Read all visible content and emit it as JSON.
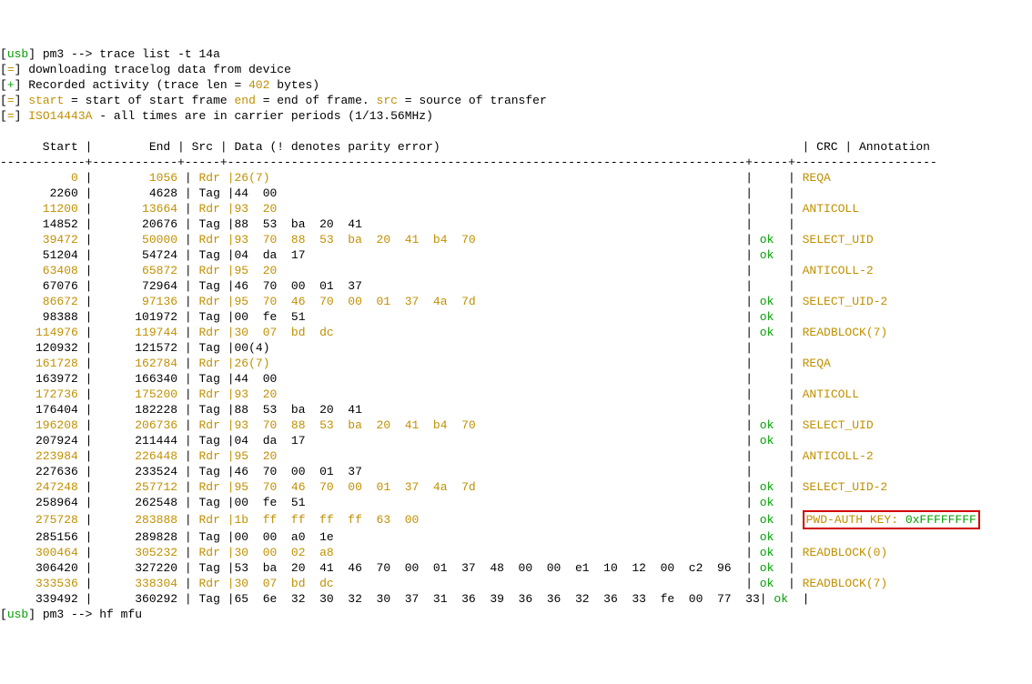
{
  "prompt1": {
    "bracket_open": "[",
    "usb": "usb",
    "bracket_close": "]",
    "sep": " pm3 --> ",
    "cmd": "trace list -t 14a"
  },
  "msg1": {
    "bracket_open": "[",
    "eq": "=",
    "bracket_close": "]",
    "text": " downloading tracelog data from device"
  },
  "msg2": {
    "bracket_open": "[",
    "plus": "+",
    "bracket_close": "]",
    "text1": " Recorded activity (trace len = ",
    "num": "402",
    "text2": " bytes)"
  },
  "msg3": {
    "bracket_open": "[",
    "eq": "=",
    "bracket_close": "]",
    "sp": " ",
    "start": "start",
    "t1": " = start of start frame ",
    "end": "end",
    "t2": " = end of frame. ",
    "src": "src",
    "t3": " = source of transfer"
  },
  "msg4": {
    "bracket_open": "[",
    "eq": "=",
    "bracket_close": "]",
    "sp": " ",
    "iso": "ISO14443A",
    "t": " - all times are in carrier periods (1/13.56MHz)"
  },
  "blank": "",
  "hdr": "      Start |        End | Src | Data (! denotes parity error)                                                   | CRC | Annotation",
  "sep": "------------+------------+-----+-------------------------------------------------------------------------+-----+--------------------",
  "rows": [
    {
      "s": "0",
      "e": "1056",
      "src": "Rdr",
      "data": [
        "26(7)"
      ],
      "ann": "REQA"
    },
    {
      "s": "       2260",
      "e": "       4628",
      "src": "Tag",
      "data_plain": "|44  00",
      "ann": ""
    },
    {
      "s": "11200",
      "e": "13664",
      "src": "Rdr",
      "data": [
        "93  20"
      ],
      "ann": "ANTICOLL"
    },
    {
      "s": "      14852",
      "e": "      20676",
      "src": "Tag",
      "data_plain": "|88  53  ba  20  41",
      "ann": ""
    },
    {
      "s": "39472",
      "e": "50000",
      "src": "Rdr",
      "data": [
        "93  70  88  53  ba  20  41  b4  70"
      ],
      "crc": "ok",
      "ann": "SELECT_UID"
    },
    {
      "s": "      51204",
      "e": "      54724",
      "src": "Tag",
      "data_plain": "|04  da  17",
      "crc": "ok",
      "ann": ""
    },
    {
      "s": "63408",
      "e": "65872",
      "src": "Rdr",
      "data": [
        "95  20"
      ],
      "ann": "ANTICOLL-2"
    },
    {
      "s": "      67076",
      "e": "      72964",
      "src": "Tag",
      "data_plain": "|46  70  00  01  37",
      "ann": ""
    },
    {
      "s": "86672",
      "e": "97136",
      "src": "Rdr",
      "data": [
        "95  70  46  70  00  01  37  4a  7d"
      ],
      "crc": "ok",
      "ann": "SELECT_UID-2"
    },
    {
      "s": "      98388",
      "e": "     101972",
      "src": "Tag",
      "data_plain": "|00  fe  51",
      "crc": "ok",
      "ann": ""
    },
    {
      "s": "114976",
      "e": "119744",
      "src": "Rdr",
      "data": [
        "30  07  bd  dc"
      ],
      "crc": "ok",
      "ann": "READBLOCK(7)"
    },
    {
      "s": "     120932",
      "e": "     121572",
      "src": "Tag",
      "data_plain": "|00(4)",
      "ann": ""
    },
    {
      "s": "161728",
      "e": "162784",
      "src": "Rdr",
      "data": [
        "26(7)"
      ],
      "ann": "REQA"
    },
    {
      "s": "     163972",
      "e": "     166340",
      "src": "Tag",
      "data_plain": "|44  00",
      "ann": ""
    },
    {
      "s": "172736",
      "e": "175200",
      "src": "Rdr",
      "data": [
        "93  20"
      ],
      "ann": "ANTICOLL"
    },
    {
      "s": "     176404",
      "e": "     182228",
      "src": "Tag",
      "data_plain": "|88  53  ba  20  41",
      "ann": ""
    },
    {
      "s": "196208",
      "e": "206736",
      "src": "Rdr",
      "data": [
        "93  70  88  53  ba  20  41  b4  70"
      ],
      "crc": "ok",
      "ann": "SELECT_UID"
    },
    {
      "s": "     207924",
      "e": "     211444",
      "src": "Tag",
      "data_plain": "|04  da  17",
      "crc": "ok",
      "ann": ""
    },
    {
      "s": "223984",
      "e": "226448",
      "src": "Rdr",
      "data": [
        "95  20"
      ],
      "ann": "ANTICOLL-2"
    },
    {
      "s": "     227636",
      "e": "     233524",
      "src": "Tag",
      "data_plain": "|46  70  00  01  37",
      "ann": ""
    },
    {
      "s": "247248",
      "e": "257712",
      "src": "Rdr",
      "data": [
        "95  70  46  70  00  01  37  4a  7d"
      ],
      "crc": "ok",
      "ann": "SELECT_UID-2"
    },
    {
      "s": "     258964",
      "e": "     262548",
      "src": "Tag",
      "data_plain": "|00  fe  51",
      "crc": "ok",
      "ann": ""
    },
    {
      "s": "275728",
      "e": "283888",
      "src": "Rdr",
      "data": [
        "1b  ff  ff  ff  ff  63  00"
      ],
      "crc": "ok",
      "ann_hl": {
        "p1": "PWD-AUTH KEY: ",
        "p2": "0xFFFFFFFF"
      }
    },
    {
      "s": "     285156",
      "e": "     289828",
      "src": "Tag",
      "data_plain": "|00  00  a0  1e",
      "crc": "ok",
      "ann": ""
    },
    {
      "s": "300464",
      "e": "305232",
      "src": "Rdr",
      "data": [
        "30  00  02  a8"
      ],
      "crc": "ok",
      "ann": "READBLOCK(0)"
    },
    {
      "s": "     306420",
      "e": "     327220",
      "src": "Tag",
      "data_plain": "|53  ba  20  41  46  70  00  01  37  48  00  00  e1  10  12  00  c2  96",
      "crc": "ok",
      "ann": ""
    },
    {
      "s": "333536",
      "e": "338304",
      "src": "Rdr",
      "data": [
        "30  07  bd  dc"
      ],
      "crc": "ok",
      "ann": "READBLOCK(7)"
    },
    {
      "s": "     339492",
      "e": "     360292",
      "src": "Tag",
      "data_plain": "|65  6e  32  30  32  30  37  31  36  39  36  36  32  36  33  fe  00  77  33",
      "crc": "ok",
      "ann": ""
    }
  ],
  "prompt2": {
    "bracket_open": "[",
    "usb": "usb",
    "bracket_close": "]",
    "sep": " pm3 --> ",
    "cmd": "hf mfu"
  }
}
